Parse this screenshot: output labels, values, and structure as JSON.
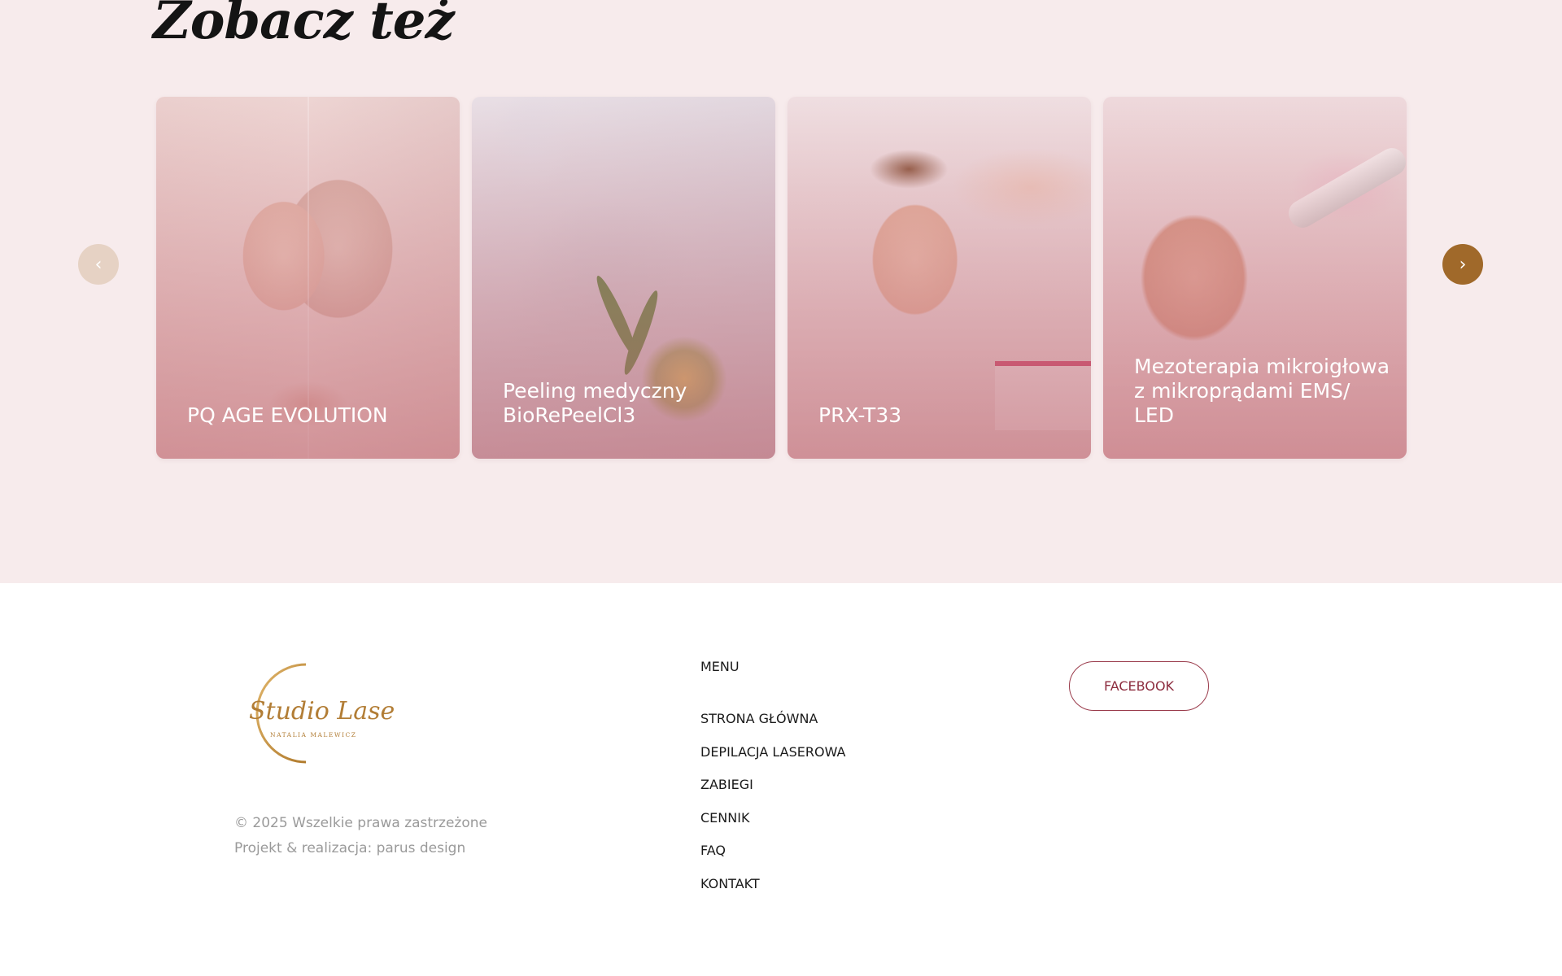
{
  "section": {
    "title": "Zobacz też"
  },
  "cards": [
    {
      "lines": [
        "PQ AGE EVOLUTION"
      ]
    },
    {
      "lines": [
        "Peeling medyczny",
        "BioRePeelCl3"
      ]
    },
    {
      "lines": [
        "PRX-T33"
      ]
    },
    {
      "lines": [
        "Mezoterapia mikroigłowa",
        "z mikroprądami EMS/ LED"
      ]
    }
  ],
  "carousel": {
    "prev_icon": "chevron-left-icon",
    "next_icon": "chevron-right-icon",
    "prev_glyph": "‹",
    "next_glyph": "›"
  },
  "footer": {
    "logo_text": "Studio Laser",
    "logo_subtext": "NATALIA MALEWICZ",
    "copyright": "© 2025 Wszelkie prawa zastrzeżone",
    "credits": "Projekt & realizacja: parus design",
    "menu_title": "MENU",
    "menu": [
      "STRONA GŁÓWNA",
      "DEPILACJA LASEROWA",
      "ZABIEGI",
      "CENNIK",
      "FAQ",
      "KONTAKT"
    ],
    "facebook_label": "FACEBOOK"
  },
  "colors": {
    "section_bg": "#f7ebec",
    "accent_gold": "#a0692a",
    "accent_wine": "#8d2d3f",
    "prev_arrow": "#e6d2c4"
  }
}
